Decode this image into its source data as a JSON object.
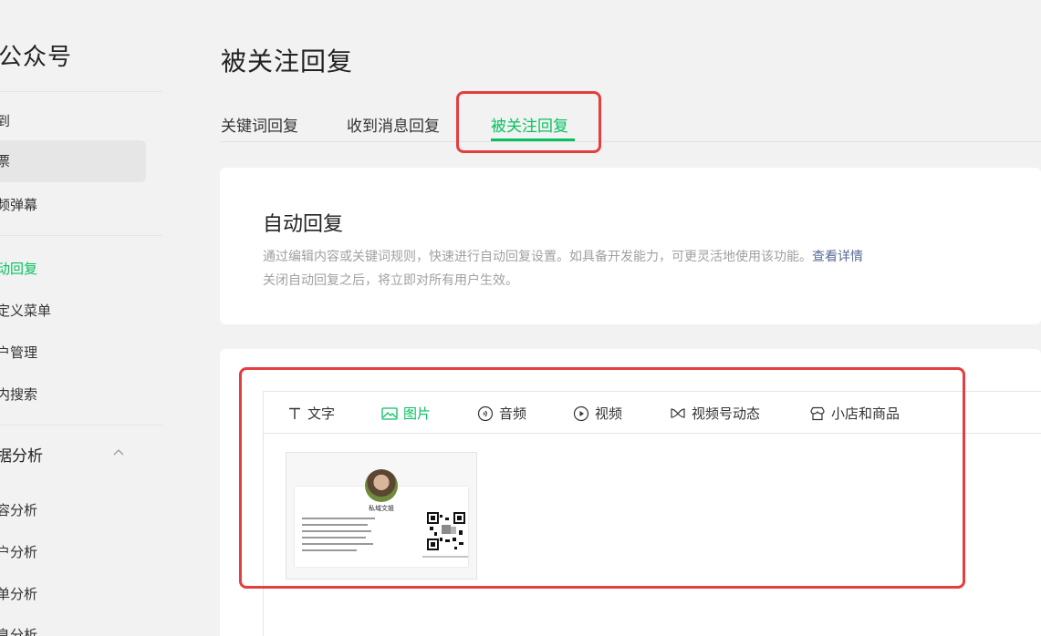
{
  "sidebar": {
    "brand": "公众号",
    "items": [
      {
        "label": "到"
      },
      {
        "label": "票"
      },
      {
        "label": "频弹幕"
      },
      {
        "label": "动回复"
      },
      {
        "label": "定义菜单"
      },
      {
        "label": "户管理"
      },
      {
        "label": "内搜索"
      }
    ],
    "group": {
      "label": "据分析"
    },
    "sub_items": [
      {
        "label": "容分析"
      },
      {
        "label": "户分析"
      },
      {
        "label": "单分析"
      },
      {
        "label": "息分析"
      }
    ]
  },
  "header": {
    "title": "被关注回复",
    "tabs": [
      {
        "label": "关键词回复"
      },
      {
        "label": "收到消息回复"
      },
      {
        "label": "被关注回复"
      }
    ]
  },
  "intro": {
    "title": "自动回复",
    "line1": "通过编辑内容或关键词规则，快速进行自动回复设置。如具备开发能力，可更灵活地使用该功能。",
    "link": "查看详情",
    "line2": "关闭自动回复之后，将立即对所有用户生效。"
  },
  "toolbar": {
    "items": [
      {
        "label": "文字",
        "icon": "text-icon"
      },
      {
        "label": "图片",
        "icon": "image-icon"
      },
      {
        "label": "音频",
        "icon": "audio-icon"
      },
      {
        "label": "视频",
        "icon": "video-icon"
      },
      {
        "label": "视频号动态",
        "icon": "channels-icon"
      },
      {
        "label": "小店和商品",
        "icon": "shop-icon"
      }
    ]
  },
  "preview": {
    "name": "私域文姐"
  },
  "colors": {
    "accent": "#07c160",
    "highlight": "#e53e3e",
    "link": "#576b95"
  }
}
